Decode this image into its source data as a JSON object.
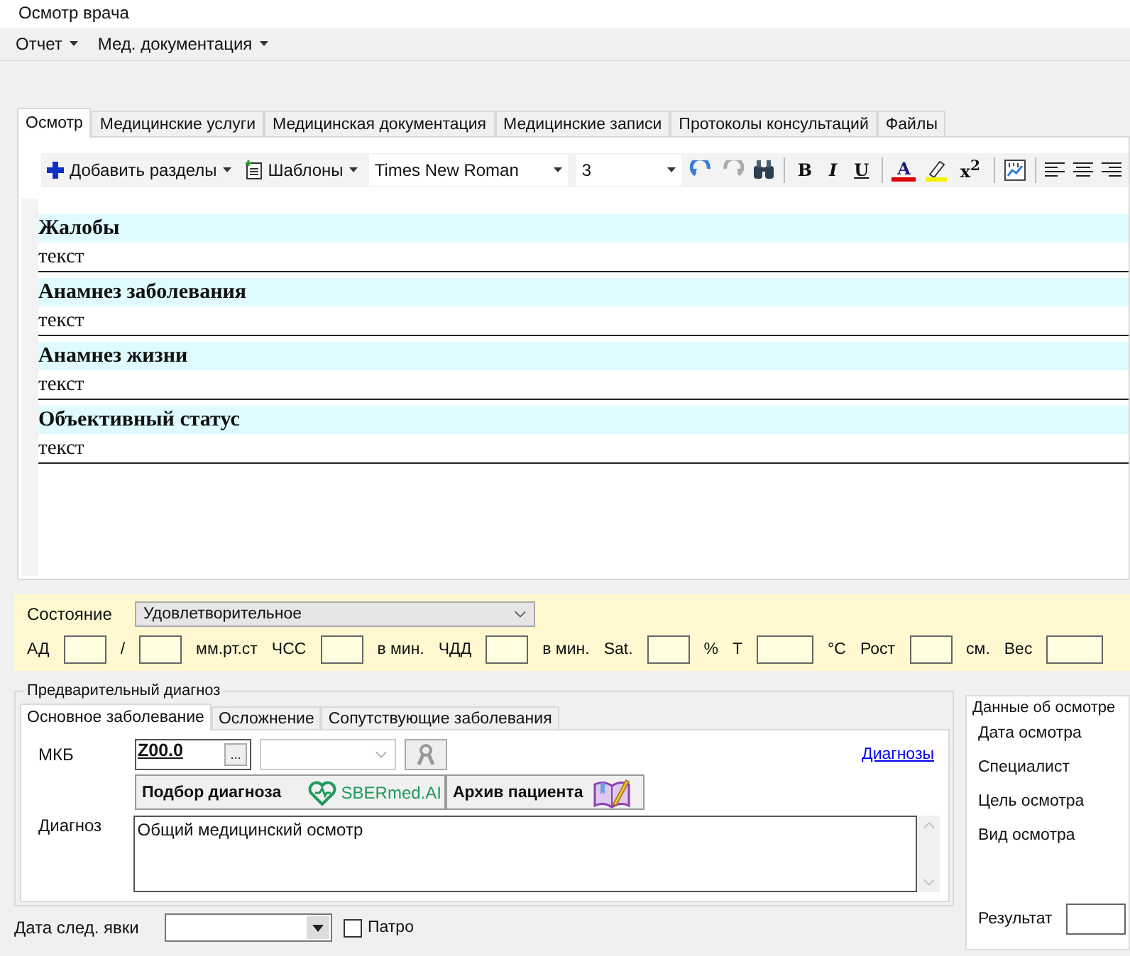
{
  "window": {
    "title": "Осмотр врача"
  },
  "menu": [
    {
      "label": "Отчет"
    },
    {
      "label": "Мед. документация"
    }
  ],
  "tabs": [
    {
      "label": "Осмотр",
      "selected": true
    },
    {
      "label": "Медицинские услуги",
      "selected": false
    },
    {
      "label": "Медицинская документация",
      "selected": false
    },
    {
      "label": "Медицинские записи",
      "selected": false
    },
    {
      "label": "Протоколы консультаций",
      "selected": false
    },
    {
      "label": "Файлы",
      "selected": false
    }
  ],
  "toolbar": {
    "add_sections": "Добавить разделы",
    "templates": "Шаблоны",
    "font": "Times New Roman",
    "font_size": "3",
    "bold": "B",
    "italic": "I",
    "underline": "U",
    "font_color": "A",
    "superscript": "x$^{2}$"
  },
  "sections": [
    {
      "title": "Жалобы",
      "text": "текст"
    },
    {
      "title": "Анамнез заболевания",
      "text": "текст"
    },
    {
      "title": "Анамнез жизни",
      "text": "текст"
    },
    {
      "title": "Объективный статус",
      "text": "текст"
    }
  ],
  "vitals": {
    "state_label": "Состояние",
    "state_value": "Удовлетворительное",
    "items": [
      {
        "kind": "label",
        "text": "АД"
      },
      {
        "kind": "input"
      },
      {
        "kind": "label",
        "text": "/"
      },
      {
        "kind": "input"
      },
      {
        "kind": "label",
        "text": "мм.рт.ст"
      },
      {
        "kind": "label",
        "text": "ЧСС"
      },
      {
        "kind": "input"
      },
      {
        "kind": "label",
        "text": "в мин."
      },
      {
        "kind": "label",
        "text": "ЧДД"
      },
      {
        "kind": "input"
      },
      {
        "kind": "label",
        "text": "в мин."
      },
      {
        "kind": "label",
        "text": "Sat."
      },
      {
        "kind": "input"
      },
      {
        "kind": "label",
        "text": "%"
      },
      {
        "kind": "label",
        "text": "Т"
      },
      {
        "kind": "input",
        "wide": true
      },
      {
        "kind": "label",
        "text": "°C"
      },
      {
        "kind": "label",
        "text": "Рост"
      },
      {
        "kind": "input"
      },
      {
        "kind": "label",
        "text": "см."
      },
      {
        "kind": "label",
        "text": "Вес"
      },
      {
        "kind": "input",
        "wide": true
      }
    ]
  },
  "diagnosis": {
    "title": "Предварительный диагноз",
    "tabs": [
      {
        "label": "Основное заболевание",
        "selected": true
      },
      {
        "label": "Осложнение",
        "selected": false
      },
      {
        "label": "Сопутствующие заболевания",
        "selected": false
      }
    ],
    "mkb_label": "МКБ",
    "mkb_code": "Z00.0",
    "ellipsis": "...",
    "link": "Диагнозы",
    "pick_button": "Подбор диагноза",
    "sber_logo": "SBERmed.AI",
    "archive_button": "Архив пациента",
    "diagnosis_label": "Диагноз",
    "diagnosis_value": "Общий медицинский осмотр"
  },
  "exam_data": {
    "title": "Данные об осмотре",
    "rows": [
      "Дата осмотра",
      "Специалист",
      "Цель осмотра",
      "Вид осмотра"
    ],
    "result_label": "Результат"
  },
  "next_visit": {
    "label": "Дата след. явки",
    "patro": {
      "label": "Патро",
      "checked": false
    }
  }
}
